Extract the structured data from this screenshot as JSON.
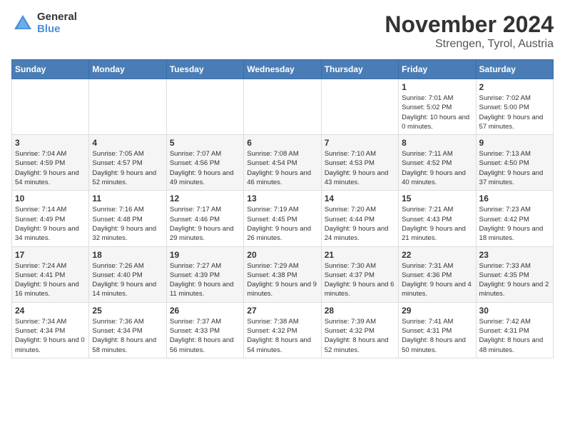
{
  "logo": {
    "general": "General",
    "blue": "Blue"
  },
  "title": "November 2024",
  "location": "Strengen, Tyrol, Austria",
  "days_header": [
    "Sunday",
    "Monday",
    "Tuesday",
    "Wednesday",
    "Thursday",
    "Friday",
    "Saturday"
  ],
  "weeks": [
    [
      {
        "day": "",
        "info": ""
      },
      {
        "day": "",
        "info": ""
      },
      {
        "day": "",
        "info": ""
      },
      {
        "day": "",
        "info": ""
      },
      {
        "day": "",
        "info": ""
      },
      {
        "day": "1",
        "info": "Sunrise: 7:01 AM\nSunset: 5:02 PM\nDaylight: 10 hours and 0 minutes."
      },
      {
        "day": "2",
        "info": "Sunrise: 7:02 AM\nSunset: 5:00 PM\nDaylight: 9 hours and 57 minutes."
      }
    ],
    [
      {
        "day": "3",
        "info": "Sunrise: 7:04 AM\nSunset: 4:59 PM\nDaylight: 9 hours and 54 minutes."
      },
      {
        "day": "4",
        "info": "Sunrise: 7:05 AM\nSunset: 4:57 PM\nDaylight: 9 hours and 52 minutes."
      },
      {
        "day": "5",
        "info": "Sunrise: 7:07 AM\nSunset: 4:56 PM\nDaylight: 9 hours and 49 minutes."
      },
      {
        "day": "6",
        "info": "Sunrise: 7:08 AM\nSunset: 4:54 PM\nDaylight: 9 hours and 46 minutes."
      },
      {
        "day": "7",
        "info": "Sunrise: 7:10 AM\nSunset: 4:53 PM\nDaylight: 9 hours and 43 minutes."
      },
      {
        "day": "8",
        "info": "Sunrise: 7:11 AM\nSunset: 4:52 PM\nDaylight: 9 hours and 40 minutes."
      },
      {
        "day": "9",
        "info": "Sunrise: 7:13 AM\nSunset: 4:50 PM\nDaylight: 9 hours and 37 minutes."
      }
    ],
    [
      {
        "day": "10",
        "info": "Sunrise: 7:14 AM\nSunset: 4:49 PM\nDaylight: 9 hours and 34 minutes."
      },
      {
        "day": "11",
        "info": "Sunrise: 7:16 AM\nSunset: 4:48 PM\nDaylight: 9 hours and 32 minutes."
      },
      {
        "day": "12",
        "info": "Sunrise: 7:17 AM\nSunset: 4:46 PM\nDaylight: 9 hours and 29 minutes."
      },
      {
        "day": "13",
        "info": "Sunrise: 7:19 AM\nSunset: 4:45 PM\nDaylight: 9 hours and 26 minutes."
      },
      {
        "day": "14",
        "info": "Sunrise: 7:20 AM\nSunset: 4:44 PM\nDaylight: 9 hours and 24 minutes."
      },
      {
        "day": "15",
        "info": "Sunrise: 7:21 AM\nSunset: 4:43 PM\nDaylight: 9 hours and 21 minutes."
      },
      {
        "day": "16",
        "info": "Sunrise: 7:23 AM\nSunset: 4:42 PM\nDaylight: 9 hours and 18 minutes."
      }
    ],
    [
      {
        "day": "17",
        "info": "Sunrise: 7:24 AM\nSunset: 4:41 PM\nDaylight: 9 hours and 16 minutes."
      },
      {
        "day": "18",
        "info": "Sunrise: 7:26 AM\nSunset: 4:40 PM\nDaylight: 9 hours and 14 minutes."
      },
      {
        "day": "19",
        "info": "Sunrise: 7:27 AM\nSunset: 4:39 PM\nDaylight: 9 hours and 11 minutes."
      },
      {
        "day": "20",
        "info": "Sunrise: 7:29 AM\nSunset: 4:38 PM\nDaylight: 9 hours and 9 minutes."
      },
      {
        "day": "21",
        "info": "Sunrise: 7:30 AM\nSunset: 4:37 PM\nDaylight: 9 hours and 6 minutes."
      },
      {
        "day": "22",
        "info": "Sunrise: 7:31 AM\nSunset: 4:36 PM\nDaylight: 9 hours and 4 minutes."
      },
      {
        "day": "23",
        "info": "Sunrise: 7:33 AM\nSunset: 4:35 PM\nDaylight: 9 hours and 2 minutes."
      }
    ],
    [
      {
        "day": "24",
        "info": "Sunrise: 7:34 AM\nSunset: 4:34 PM\nDaylight: 9 hours and 0 minutes."
      },
      {
        "day": "25",
        "info": "Sunrise: 7:36 AM\nSunset: 4:34 PM\nDaylight: 8 hours and 58 minutes."
      },
      {
        "day": "26",
        "info": "Sunrise: 7:37 AM\nSunset: 4:33 PM\nDaylight: 8 hours and 56 minutes."
      },
      {
        "day": "27",
        "info": "Sunrise: 7:38 AM\nSunset: 4:32 PM\nDaylight: 8 hours and 54 minutes."
      },
      {
        "day": "28",
        "info": "Sunrise: 7:39 AM\nSunset: 4:32 PM\nDaylight: 8 hours and 52 minutes."
      },
      {
        "day": "29",
        "info": "Sunrise: 7:41 AM\nSunset: 4:31 PM\nDaylight: 8 hours and 50 minutes."
      },
      {
        "day": "30",
        "info": "Sunrise: 7:42 AM\nSunset: 4:31 PM\nDaylight: 8 hours and 48 minutes."
      }
    ]
  ]
}
